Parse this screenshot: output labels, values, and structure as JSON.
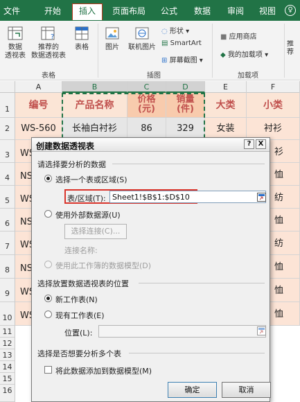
{
  "ribbon": {
    "tabs": [
      "文件",
      "开始",
      "插入",
      "页面布局",
      "公式",
      "数据",
      "审阅",
      "视图"
    ],
    "active_tab": "插入",
    "groups": {
      "tables": {
        "name": "表格",
        "pivot_table_line1": "数据",
        "pivot_table_line2": "透视表",
        "recommended_line1": "推荐的",
        "recommended_line2": "数据透视表",
        "table": "表格"
      },
      "illustrations": {
        "name": "插图",
        "picture": "图片",
        "online_picture": "联机图片",
        "shapes": "形状",
        "smartart": "SmartArt",
        "screenshot": "屏幕截图"
      },
      "addins": {
        "name": "加载项",
        "store": "应用商店",
        "my_addins": "我的加载项"
      },
      "cut_label": "推荐"
    }
  },
  "sheet": {
    "columns": [
      "A",
      "B",
      "C",
      "D",
      "E",
      "F"
    ],
    "selected_columns": [
      "B",
      "C",
      "D"
    ],
    "rows": [
      "1",
      "2",
      "3",
      "4",
      "5",
      "6",
      "7",
      "8",
      "9",
      "10",
      "11",
      "12",
      "13",
      "14",
      "15",
      "16"
    ],
    "header": {
      "a": "编号",
      "b": "产品名称",
      "c_line1": "价格",
      "c_line2": "(元)",
      "d_line1": "销量",
      "d_line2": "(件)",
      "e": "大类",
      "f": "小类"
    },
    "row2": {
      "a": "WS-560",
      "b": "长袖白衬衫",
      "c": "86",
      "d": "329",
      "e": "女装",
      "f": "衬衫"
    },
    "partial_a": [
      "WS",
      "NS",
      "WS",
      "NS",
      "WS",
      "NS",
      "WS",
      "WS"
    ],
    "partial_f": [
      "衫",
      "恤",
      "纺",
      "恤",
      "纺",
      "恤",
      "恤",
      "恤"
    ]
  },
  "dialog": {
    "title": "创建数据透视表",
    "help": "?",
    "close": "X",
    "section_data": "请选择要分析的数据",
    "opt_range": "选择一个表或区域(S)",
    "range_label": "表/区域(T):",
    "range_value": "Sheet1!$B$1:$D$10",
    "opt_external": "使用外部数据源(U)",
    "choose_conn": "选择连接(C)...",
    "conn_name": "连接名称:",
    "opt_model": "使用此工作簿的数据模型(D)",
    "section_location": "选择放置数据透视表的位置",
    "opt_new_sheet": "新工作表(N)",
    "opt_existing_sheet": "现有工作表(E)",
    "position_label": "位置(L):",
    "section_multi": "选择是否想要分析多个表",
    "add_to_model": "将此数据添加到数据模型(M)",
    "ok": "确定",
    "cancel": "取消"
  },
  "colors": {
    "excel_green": "#217346",
    "header_fill": "#fbe5d6",
    "header_text": "#c0504d",
    "range_highlight": "#d9342b"
  }
}
